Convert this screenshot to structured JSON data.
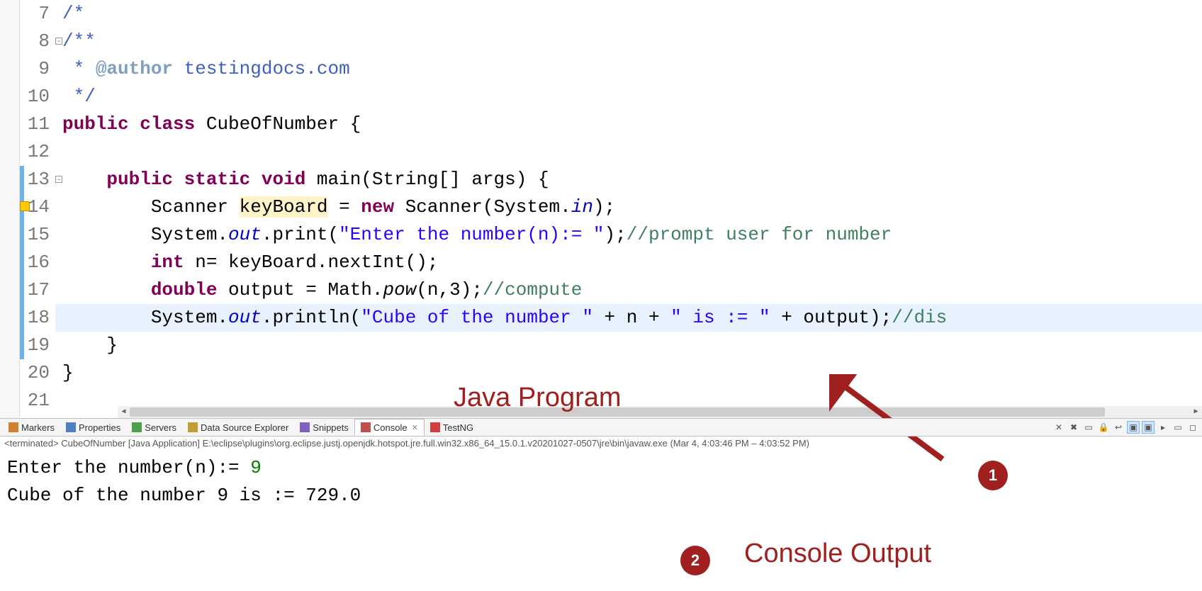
{
  "editor": {
    "lines": [
      {
        "num": 7,
        "tokens": [
          {
            "t": "jdoc",
            "v": "/*"
          }
        ]
      },
      {
        "num": 8,
        "tokens": [
          {
            "t": "jdoc",
            "v": "/**"
          }
        ]
      },
      {
        "num": 9,
        "tokens": [
          {
            "t": "jdoc",
            "v": " * "
          },
          {
            "t": "jdoc-tag",
            "v": "@author"
          },
          {
            "t": "jdoc",
            "v": " testingdocs.com"
          }
        ]
      },
      {
        "num": 10,
        "tokens": [
          {
            "t": "jdoc",
            "v": " */"
          }
        ]
      },
      {
        "num": 11,
        "tokens": [
          {
            "t": "kw",
            "v": "public"
          },
          {
            "t": "",
            "v": " "
          },
          {
            "t": "kw",
            "v": "class"
          },
          {
            "t": "",
            "v": " CubeOfNumber {"
          }
        ]
      },
      {
        "num": 12,
        "tokens": []
      },
      {
        "num": 13,
        "tokens": [
          {
            "t": "",
            "v": "    "
          },
          {
            "t": "kw",
            "v": "public"
          },
          {
            "t": "",
            "v": " "
          },
          {
            "t": "kw",
            "v": "static"
          },
          {
            "t": "",
            "v": " "
          },
          {
            "t": "kw",
            "v": "void"
          },
          {
            "t": "",
            "v": " main(String[] args) {"
          }
        ]
      },
      {
        "num": 14,
        "tokens": [
          {
            "t": "",
            "v": "        Scanner "
          },
          {
            "t": "var-hl",
            "v": "keyBoard"
          },
          {
            "t": "",
            "v": " = "
          },
          {
            "t": "kw",
            "v": "new"
          },
          {
            "t": "",
            "v": " Scanner(System."
          },
          {
            "t": "field",
            "v": "in"
          },
          {
            "t": "",
            "v": ");"
          }
        ]
      },
      {
        "num": 15,
        "tokens": [
          {
            "t": "",
            "v": "        System."
          },
          {
            "t": "field",
            "v": "out"
          },
          {
            "t": "",
            "v": ".print("
          },
          {
            "t": "str",
            "v": "\"Enter the number(n):= \""
          },
          {
            "t": "",
            "v": ");"
          },
          {
            "t": "comment",
            "v": "//prompt user for number"
          }
        ]
      },
      {
        "num": 16,
        "tokens": [
          {
            "t": "",
            "v": "        "
          },
          {
            "t": "kw",
            "v": "int"
          },
          {
            "t": "",
            "v": " n= keyBoard.nextInt();"
          }
        ]
      },
      {
        "num": 17,
        "tokens": [
          {
            "t": "",
            "v": "        "
          },
          {
            "t": "kw",
            "v": "double"
          },
          {
            "t": "",
            "v": " output = Math."
          },
          {
            "t": "meth-it",
            "v": "pow"
          },
          {
            "t": "",
            "v": "(n,3);"
          },
          {
            "t": "comment",
            "v": "//compute"
          }
        ]
      },
      {
        "num": 18,
        "hl": true,
        "tokens": [
          {
            "t": "",
            "v": "        System."
          },
          {
            "t": "field",
            "v": "out"
          },
          {
            "t": "",
            "v": ".println("
          },
          {
            "t": "str",
            "v": "\"Cube of the number \""
          },
          {
            "t": "",
            "v": " + n + "
          },
          {
            "t": "str",
            "v": "\" is := \""
          },
          {
            "t": "",
            "v": " + output);"
          },
          {
            "t": "comment",
            "v": "//dis"
          }
        ]
      },
      {
        "num": 19,
        "tokens": [
          {
            "t": "",
            "v": "    }"
          }
        ]
      },
      {
        "num": 20,
        "tokens": [
          {
            "t": "",
            "v": "}"
          }
        ]
      },
      {
        "num": 21,
        "tokens": []
      }
    ]
  },
  "tabs": {
    "items": [
      {
        "label": "Markers"
      },
      {
        "label": "Properties"
      },
      {
        "label": "Servers"
      },
      {
        "label": "Data Source Explorer"
      },
      {
        "label": "Snippets"
      },
      {
        "label": "Console",
        "active": true
      },
      {
        "label": "TestNG"
      }
    ]
  },
  "console_status": "<terminated> CubeOfNumber [Java Application] E:\\eclipse\\plugins\\org.eclipse.justj.openjdk.hotspot.jre.full.win32.x86_64_15.0.1.v20201027-0507\\jre\\bin\\javaw.exe  (Mar 4,        4:03:46 PM – 4:03:52 PM)",
  "console": {
    "line1_prefix": "Enter the number(n):= ",
    "line1_input": "9",
    "line2": "Cube of the number 9 is := 729.0"
  },
  "annotations": {
    "label1": "Java Program",
    "label2": "Console Output",
    "badge1": "1",
    "badge2": "2"
  }
}
